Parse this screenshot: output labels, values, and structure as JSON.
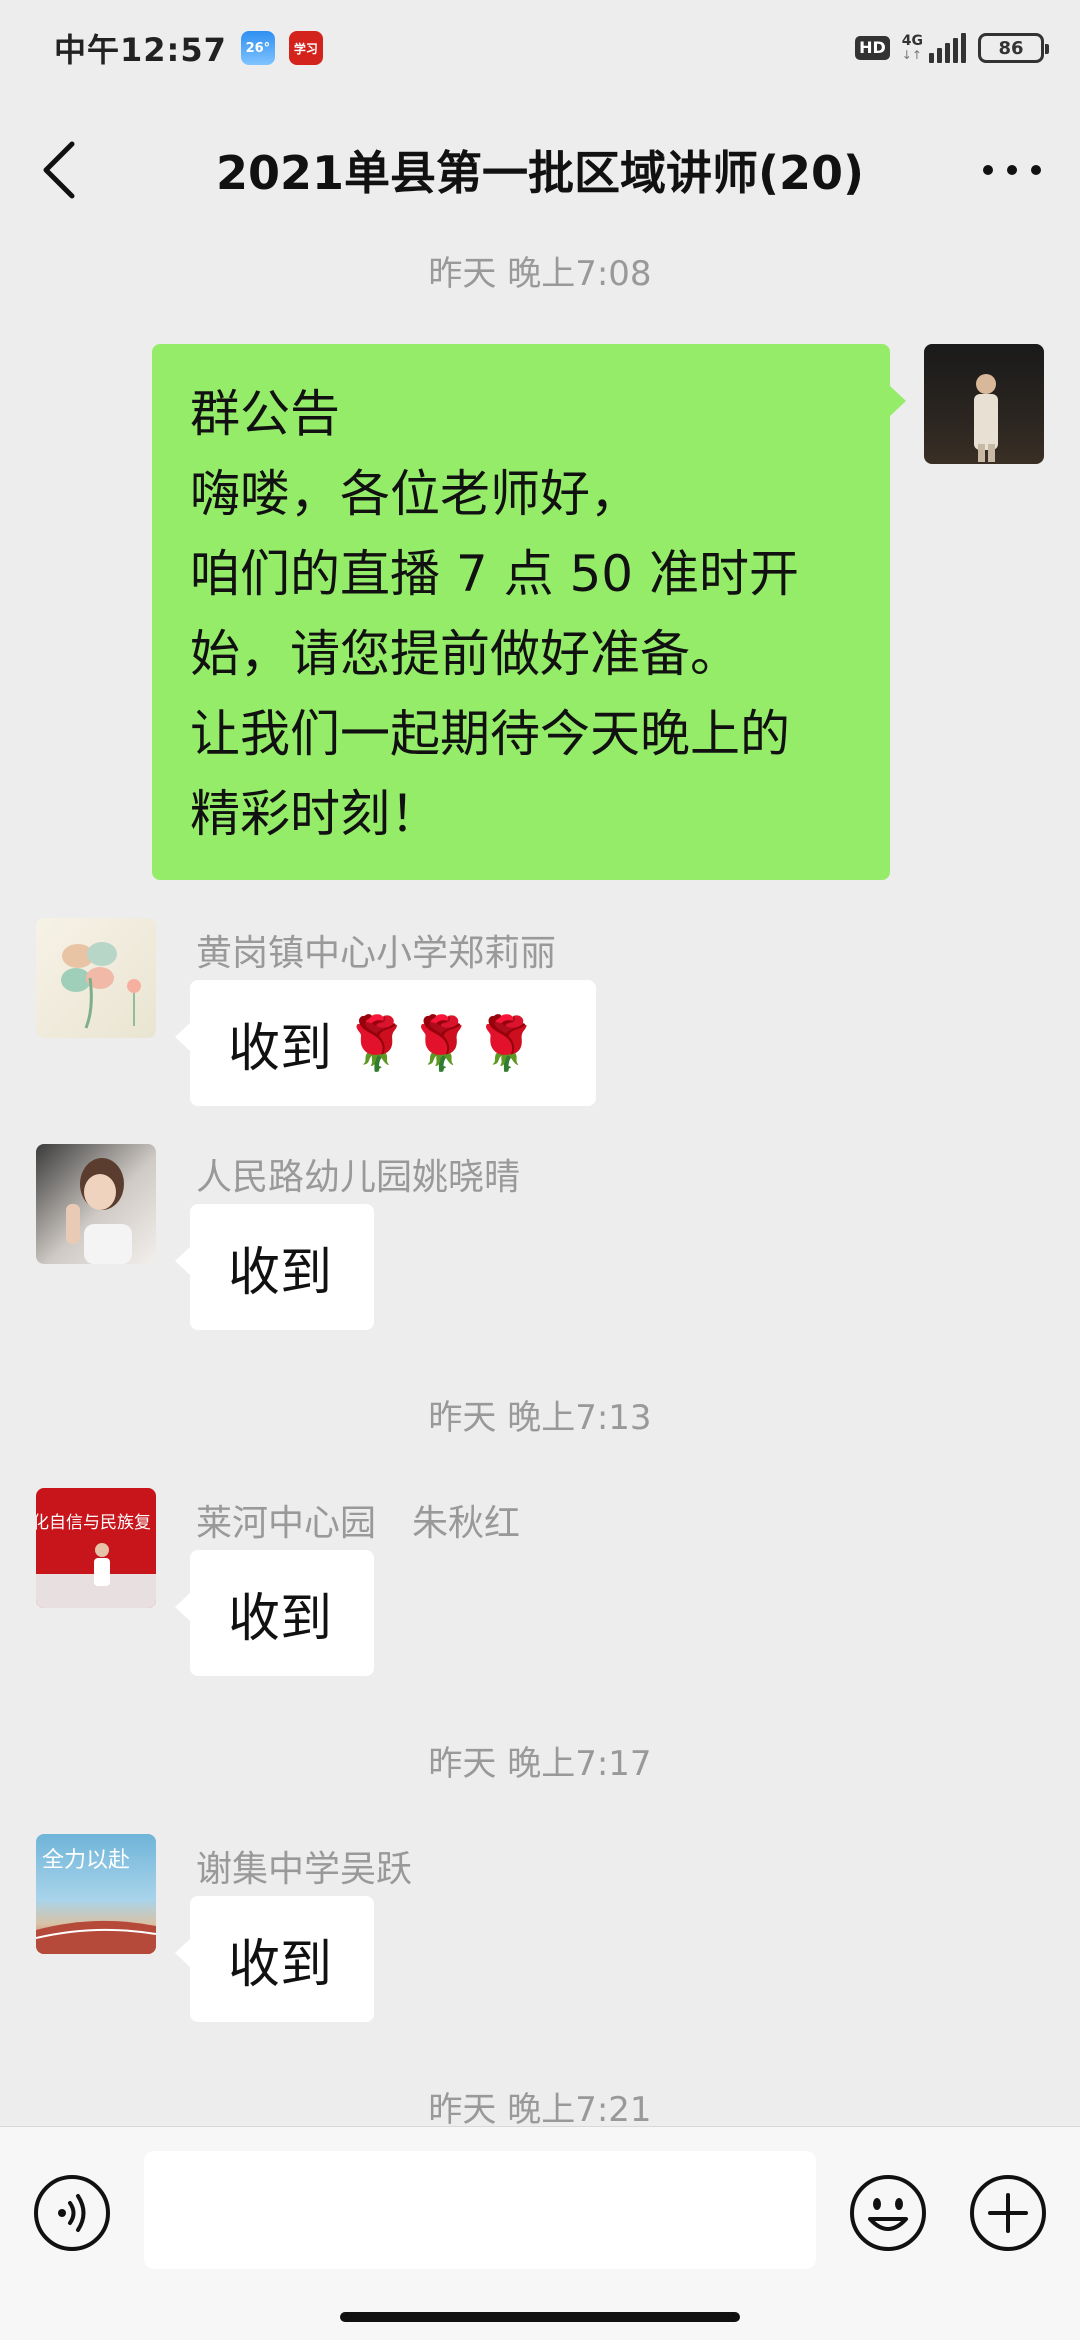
{
  "status_bar": {
    "time": "中午12:57",
    "weather_icon_text": "26°",
    "xuexi_icon_text": "学习",
    "hd": "HD",
    "network": "4G",
    "network_arrows": "↓↑",
    "battery": "86"
  },
  "header": {
    "title": "2021单县第一批区域讲师(20)",
    "back_icon": "chevron-left-icon",
    "more_icon": "more-dots-icon"
  },
  "messages": [
    {
      "type": "timestamp",
      "text": "昨天 晚上7:08"
    },
    {
      "type": "outgoing",
      "lines": [
        "群公告",
        "嗨喽，各位老师好，",
        "咱们的直播 7 点 50 准时开",
        "始，请您提前做好准备。",
        "让我们一起期待今天晚上的",
        "精彩时刻！"
      ]
    },
    {
      "type": "incoming",
      "sender": "黄岗镇中心小学郑莉丽",
      "text": "收到",
      "emoji": "🌹🌹🌹"
    },
    {
      "type": "incoming",
      "sender": "人民路幼儿园姚晓晴",
      "text": "收到"
    },
    {
      "type": "timestamp",
      "text": "昨天 晚上7:13"
    },
    {
      "type": "incoming",
      "sender": "莱河中心园　朱秋红",
      "text": "收到"
    },
    {
      "type": "timestamp",
      "text": "昨天 晚上7:17"
    },
    {
      "type": "incoming",
      "sender": "谢集中学吴跃",
      "text": "收到"
    },
    {
      "type": "timestamp",
      "text": "昨天 晚上7:21"
    }
  ],
  "avatar_texts": {
    "zhu_banner": "化自信与民族复",
    "wu_banner": "全力以赴"
  },
  "input_bar": {
    "placeholder": "",
    "voice_icon": "voice-icon",
    "emoji_icon": "emoji-icon",
    "plus_icon": "plus-icon"
  },
  "colors": {
    "background": "#ededed",
    "outgoing_bubble": "#95ec69",
    "incoming_bubble": "#ffffff",
    "meta_text": "#999999"
  }
}
